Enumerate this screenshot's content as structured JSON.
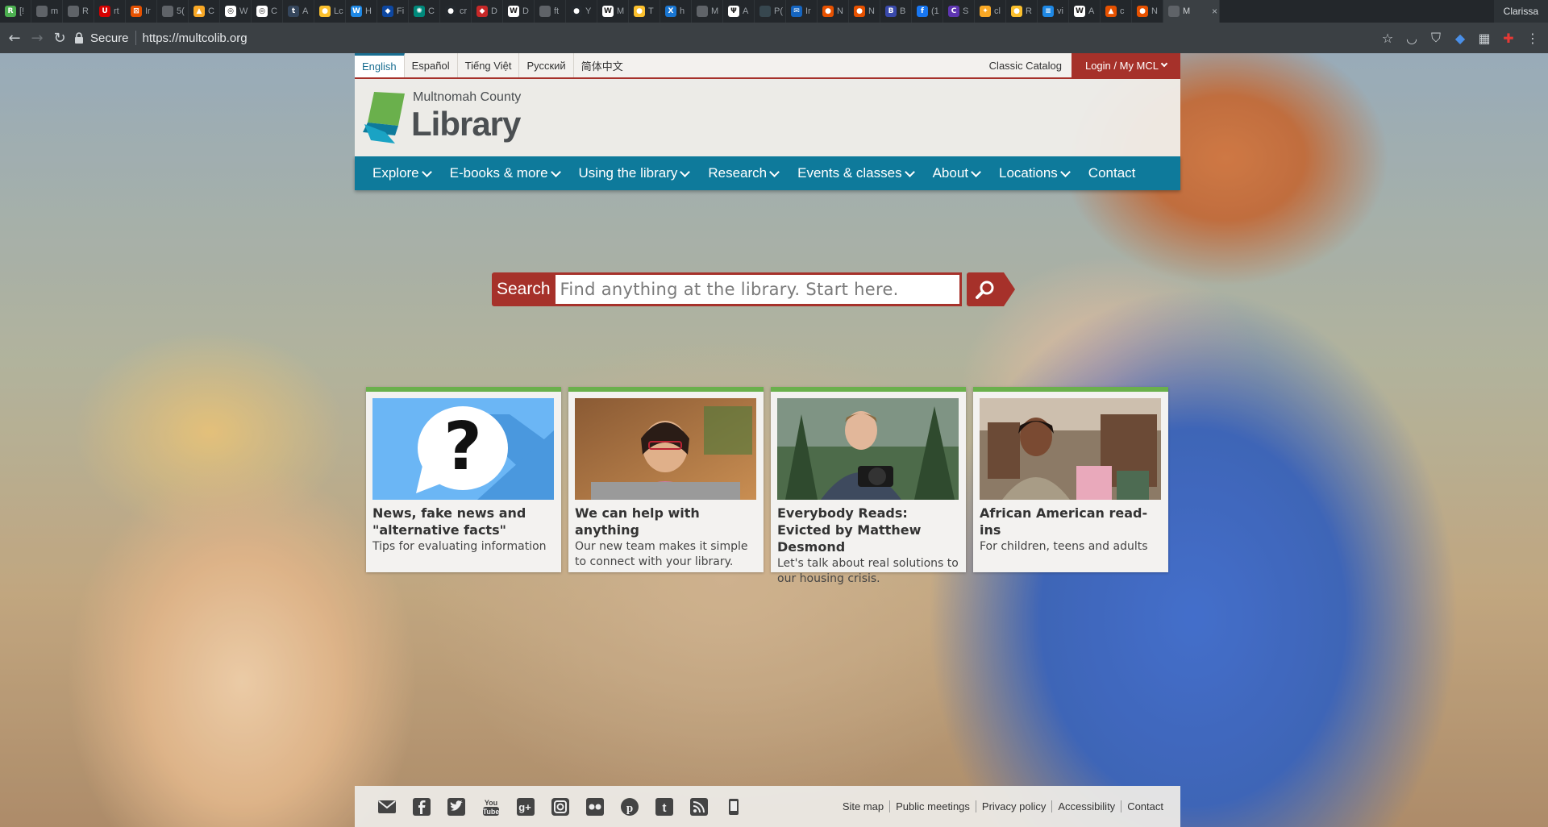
{
  "browser": {
    "tabs": [
      {
        "label": "[!",
        "color": "#4caf50",
        "glyph": "R"
      },
      {
        "label": "m",
        "color": "#5f6368",
        "glyph": ""
      },
      {
        "label": "R",
        "color": "#5f6368",
        "glyph": ""
      },
      {
        "label": "rt",
        "color": "#d50000",
        "glyph": "U"
      },
      {
        "label": "Ir",
        "color": "#e65100",
        "glyph": "⊠"
      },
      {
        "label": "5(",
        "color": "#5f6368",
        "glyph": ""
      },
      {
        "label": "C",
        "color": "#f9a825",
        "glyph": "▲"
      },
      {
        "label": "W",
        "color": "#ffffff",
        "glyph": "◎"
      },
      {
        "label": "C",
        "color": "#ffffff",
        "glyph": "◎"
      },
      {
        "label": "A",
        "color": "#35465c",
        "glyph": "t"
      },
      {
        "label": "Lc",
        "color": "#fbc02d",
        "glyph": "●"
      },
      {
        "label": "H",
        "color": "#1e88e5",
        "glyph": "W"
      },
      {
        "label": "Fi",
        "color": "#0d47a1",
        "glyph": "◆"
      },
      {
        "label": "C",
        "color": "#00897b",
        "glyph": "✺"
      },
      {
        "label": "cr",
        "color": "#24292e",
        "glyph": "●"
      },
      {
        "label": "D",
        "color": "#c62828",
        "glyph": "◆"
      },
      {
        "label": "D",
        "color": "#ffffff",
        "glyph": "W"
      },
      {
        "label": "ft",
        "color": "#5f6368",
        "glyph": ""
      },
      {
        "label": "Y",
        "color": "#24292e",
        "glyph": "●"
      },
      {
        "label": "M",
        "color": "#ffffff",
        "glyph": "W"
      },
      {
        "label": "T",
        "color": "#fbc02d",
        "glyph": "●"
      },
      {
        "label": "h",
        "color": "#1976d2",
        "glyph": "X"
      },
      {
        "label": "M",
        "color": "#5f6368",
        "glyph": ""
      },
      {
        "label": "A",
        "color": "#ffffff",
        "glyph": "Ψ"
      },
      {
        "label": "P(",
        "color": "#37474f",
        "glyph": ""
      },
      {
        "label": "Ir",
        "color": "#1565c0",
        "glyph": "✉"
      },
      {
        "label": "N",
        "color": "#e65100",
        "glyph": "●"
      },
      {
        "label": "N",
        "color": "#e65100",
        "glyph": "●"
      },
      {
        "label": "B",
        "color": "#3949ab",
        "glyph": "B"
      },
      {
        "label": "(1",
        "color": "#1877f2",
        "glyph": "f"
      },
      {
        "label": "S",
        "color": "#5e35b1",
        "glyph": "C"
      },
      {
        "label": "cl",
        "color": "#f9a825",
        "glyph": "✦"
      },
      {
        "label": "R",
        "color": "#fbc02d",
        "glyph": "●"
      },
      {
        "label": "vi",
        "color": "#1e88e5",
        "glyph": "≡"
      },
      {
        "label": "A",
        "color": "#ffffff",
        "glyph": "W"
      },
      {
        "label": "c",
        "color": "#e65100",
        "glyph": "▲"
      },
      {
        "label": "N",
        "color": "#e65100",
        "glyph": "●"
      },
      {
        "label": "M",
        "color": "#5f6368",
        "glyph": ""
      }
    ],
    "profile_name": "Clarissa",
    "secure_label": "Secure",
    "url": "https://multcolib.org"
  },
  "site": {
    "languages": [
      "English",
      "Español",
      "Tiếng Việt",
      "Русский",
      "简体中文"
    ],
    "classic_catalog": "Classic Catalog",
    "login_label": "Login / My MCL",
    "logo_county": "Multnomah County",
    "logo_library": "Library",
    "nav": [
      {
        "label": "Explore",
        "has_menu": true
      },
      {
        "label": "E-books & more",
        "has_menu": true
      },
      {
        "label": "Using the library",
        "has_menu": true
      },
      {
        "label": "Research",
        "has_menu": true
      },
      {
        "label": "Events & classes",
        "has_menu": true
      },
      {
        "label": "About",
        "has_menu": true
      },
      {
        "label": "Locations",
        "has_menu": true
      },
      {
        "label": "Contact",
        "has_menu": false
      }
    ],
    "search": {
      "label": "Search",
      "placeholder": "Find anything at the library. Start here."
    },
    "cards": [
      {
        "title": "News, fake news and \"alternative facts\"",
        "subtitle": "Tips for evaluating information"
      },
      {
        "title": "We can help with anything",
        "subtitle": "Our new team makes it simple to connect with your library."
      },
      {
        "title": "Everybody Reads: Evicted by Matthew Desmond",
        "subtitle": "Let's talk about real solutions to our housing crisis."
      },
      {
        "title": "African American read-ins",
        "subtitle": "For children, teens and adults"
      }
    ],
    "footer_links": [
      "Site map",
      "Public meetings",
      "Privacy policy",
      "Accessibility",
      "Contact"
    ],
    "social_icons": [
      "email-icon",
      "facebook-icon",
      "twitter-icon",
      "youtube-icon",
      "google-plus-icon",
      "instagram-icon",
      "flickr-icon",
      "pinterest-icon",
      "tumblr-icon",
      "rss-icon",
      "mobile-icon"
    ],
    "colors": {
      "brand_red": "#a6312a",
      "nav_teal": "#0e7a9b",
      "card_accent": "#6ab04c"
    }
  }
}
